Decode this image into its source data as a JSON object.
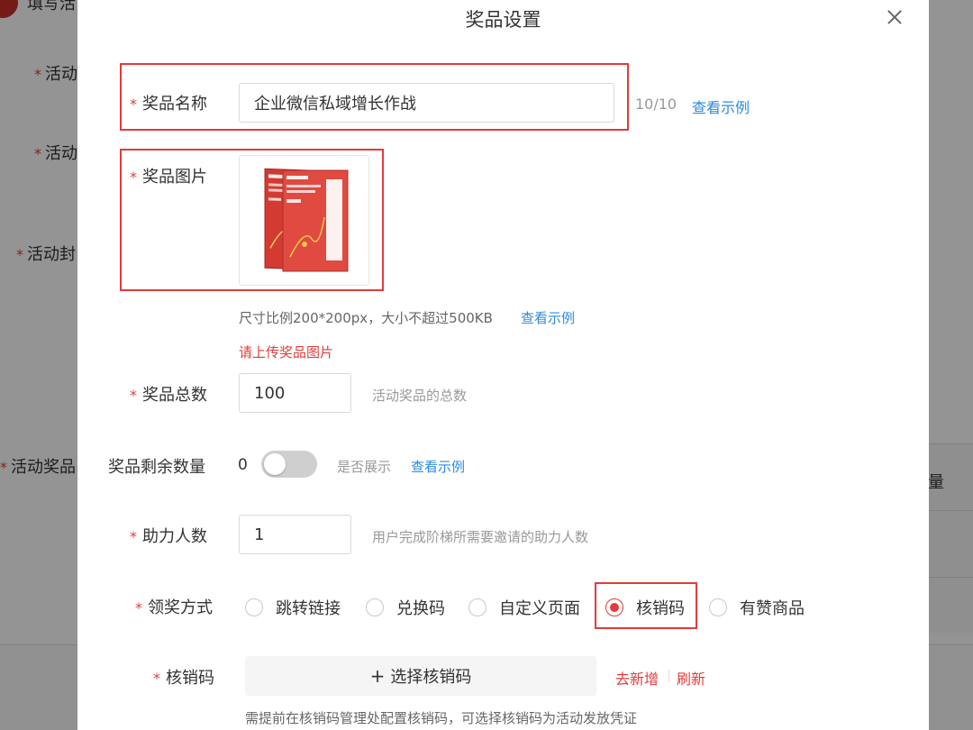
{
  "background": {
    "top_text": "填写活",
    "labels": [
      "活动",
      "活动",
      "活动封",
      "活动奖品"
    ],
    "table_cell": "量"
  },
  "modal": {
    "title": "奖品设置",
    "fields": {
      "prize_name": {
        "label": "奖品名称",
        "value": "企业微信私域增长作战",
        "counter": "10/10",
        "example_link": "查看示例"
      },
      "prize_image": {
        "label": "奖品图片",
        "hint": "尺寸比例200*200px，大小不超过500KB",
        "example_link": "查看示例",
        "error": "请上传奖品图片"
      },
      "prize_total": {
        "label": "奖品总数",
        "value": "100",
        "hint": "活动奖品的总数"
      },
      "prize_remaining": {
        "label": "奖品剩余数量",
        "value": "0",
        "toggle_on": false,
        "hint": "是否展示",
        "example_link": "查看示例"
      },
      "helpers": {
        "label": "助力人数",
        "value": "1",
        "hint": "用户完成阶梯所需要邀请的助力人数"
      },
      "claim_method": {
        "label": "领奖方式",
        "options": [
          "跳转链接",
          "兑换码",
          "自定义页面",
          "核销码",
          "有赞商品"
        ],
        "selected": "核销码"
      },
      "verify_code": {
        "label": "核销码",
        "select_label": "选择核销码",
        "add_link": "去新增",
        "refresh_link": "刷新",
        "hint": "需提前在核销码管理处配置核销码，可选择核销码为活动发放凭证"
      }
    }
  },
  "colors": {
    "accent_red": "#e23b3b",
    "link_blue": "#2b8ae0"
  }
}
